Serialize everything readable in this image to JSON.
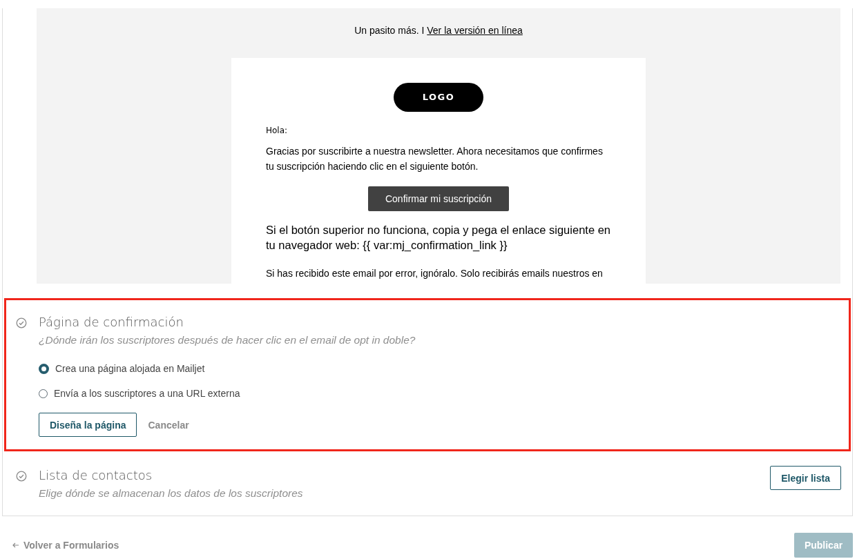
{
  "preview": {
    "header_text": "Un pasito más. I",
    "header_link": "Ver la versión en línea",
    "logo": "LOGO",
    "greeting": "Hola:",
    "intro": "Gracias por suscribirte a nuestra newsletter. Ahora necesitamos que confirmes tu suscripción haciendo clic en el siguiente botón.",
    "confirm_button": "Confirmar mi suscripción",
    "fallback": "Si el botón superior no funciona, copia y pega el enlace siguiente en tu navegador web: {{ var:mj_confirmation_link }}",
    "footer_line": "Si has recibido este email por error, ignóralo. Solo recibirás emails nuestros en"
  },
  "sections": [
    {
      "title": "Página de confirmación",
      "subtitle": "¿Dónde irán los suscriptores después de hacer clic en el email de opt in doble?",
      "highlighted": true,
      "options": [
        {
          "label": "Crea una página alojada en Mailjet",
          "selected": true
        },
        {
          "label": "Envía a los suscriptores a una URL externa",
          "selected": false
        }
      ],
      "primary_button": "Diseña la página",
      "cancel_button": "Cancelar"
    },
    {
      "title": "Lista de contactos",
      "subtitle": "Elige dónde se almacenan los datos de los suscriptores",
      "highlighted": false,
      "side_button": "Elegir lista"
    }
  ],
  "footer": {
    "back_link": "Volver a Formularios",
    "publish_button": "Publicar",
    "publish_disabled": true
  }
}
